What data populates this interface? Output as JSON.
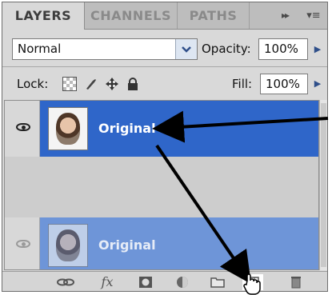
{
  "tabs": [
    {
      "label": "LAYERS"
    },
    {
      "label": "CHANNELS"
    },
    {
      "label": "PATHS"
    }
  ],
  "tab_controls": {
    "forward_icon": "fast-forward-icon",
    "menu_icon": "panel-menu-icon",
    "forward_glyph": "▸▸",
    "menu_glyph": "▾≡"
  },
  "blend": {
    "value": "Normal",
    "arrow_icon": "chevron-down-icon"
  },
  "opacity": {
    "label": "Opacity:",
    "value": "100%"
  },
  "lock": {
    "label": "Lock:",
    "icons": [
      "lock-transparency-icon",
      "lock-paint-brush-icon",
      "lock-move-icon",
      "lock-all-icon"
    ]
  },
  "fill": {
    "label": "Fill:",
    "value": "100%"
  },
  "layers": [
    {
      "name": "Original",
      "selected": true,
      "visible": true
    },
    {
      "name": "Original",
      "selected": false,
      "visible": true
    }
  ],
  "toolbar": {
    "icons": [
      "link-layers-icon",
      "layer-style-fx-icon",
      "add-mask-icon",
      "adjustment-layer-icon",
      "new-group-icon",
      "new-layer-icon",
      "trash-icon"
    ],
    "fx_glyph": "fx"
  },
  "colors": {
    "selected_row": "#2f66c9",
    "drag_row": "#6e95d8",
    "panel_bg": "#d9d9d9",
    "arrow": "#000000"
  },
  "annotation": {
    "arrows": 2,
    "cursor_icon": "hand-cursor-icon"
  }
}
